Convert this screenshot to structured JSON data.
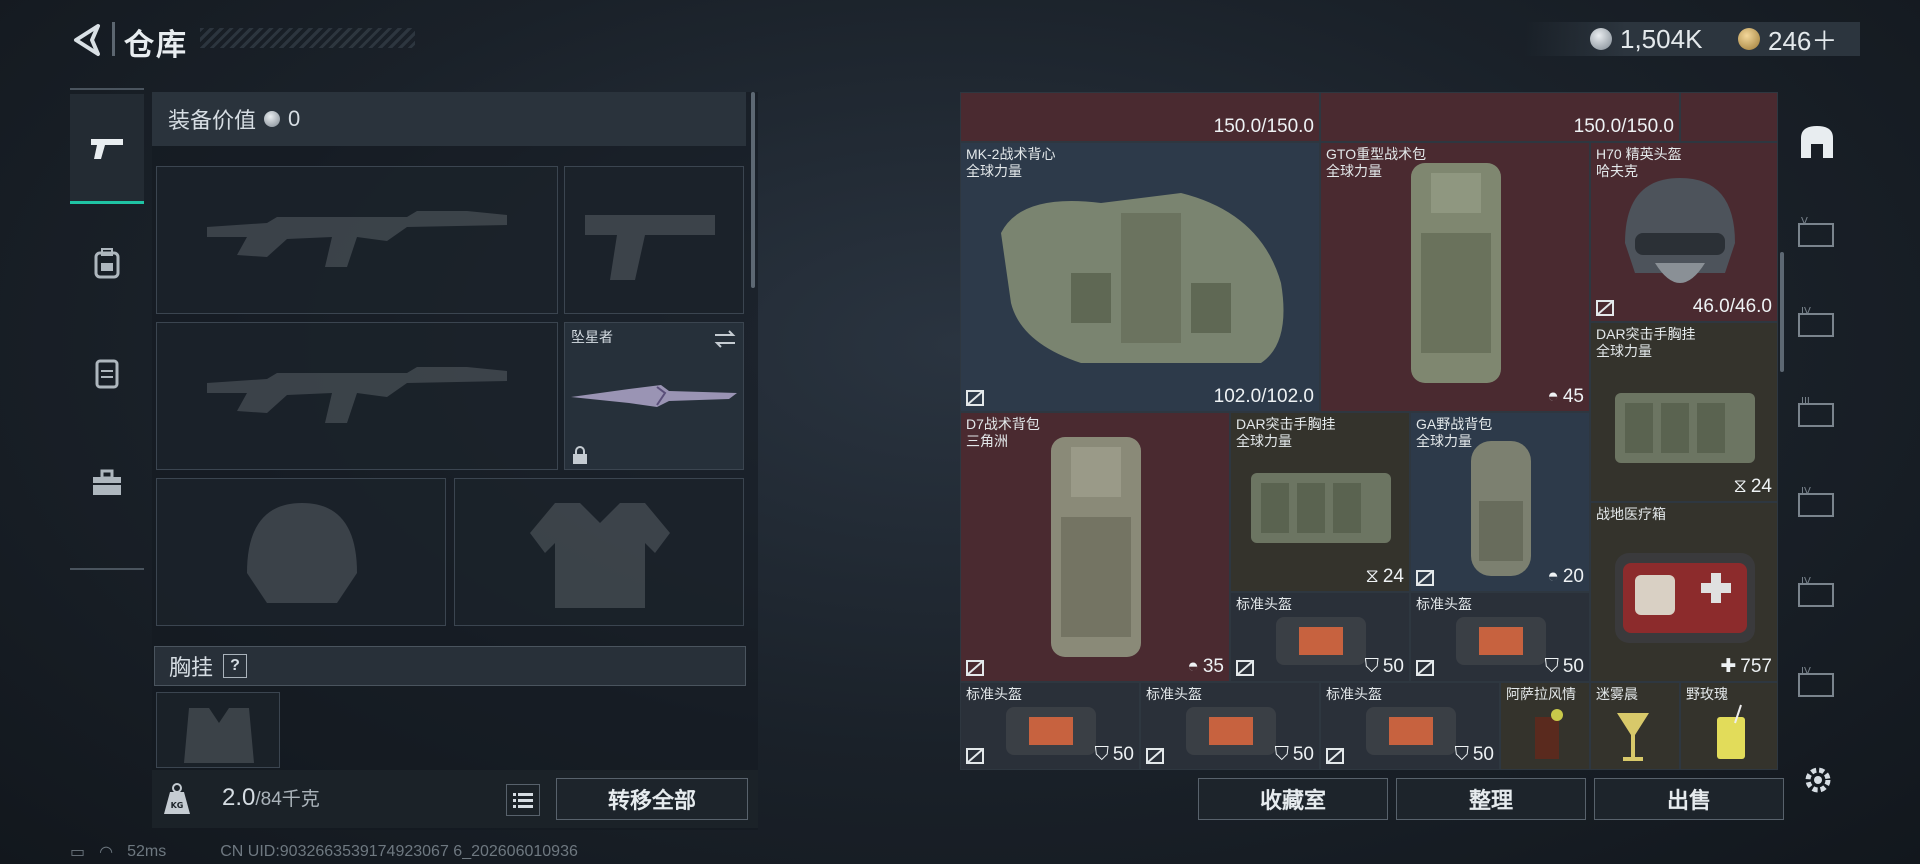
{
  "header": {
    "title": "仓库",
    "silver": "1,504K",
    "gold": "246＋"
  },
  "sidetabs": [
    {
      "icon": "pistol-icon"
    },
    {
      "icon": "backpack-icon"
    },
    {
      "icon": "vest-icon"
    },
    {
      "icon": "toolbox-icon"
    }
  ],
  "left": {
    "value_label": "装备价值",
    "value": "0",
    "melee_name": "坠星者",
    "section_label": "胸挂",
    "section_help": "?",
    "weight_current": "2.0",
    "weight_total": "/84千克",
    "transfer_label": "转移全部"
  },
  "grid": {
    "top_left_val": "150.0/150.0",
    "top_mid_val": "150.0/150.0",
    "items": [
      {
        "name": "MK-2战术背心",
        "sub": "全球力量",
        "val": "102.0/102.0",
        "color": "#8f9a84"
      },
      {
        "name": "GTO重型战术包",
        "sub": "全球力量",
        "val": "45",
        "color": "#7f8770"
      },
      {
        "name": "H70 精英头盔",
        "sub": "哈夫克",
        "val": "46.0/46.0",
        "color": "#5a6068"
      },
      {
        "name": "DAR突击手胸挂",
        "sub": "全球力量",
        "val": "24",
        "color": "#6c7562"
      },
      {
        "name": "D7战术背包",
        "sub": "三角洲",
        "val": "35",
        "color": "#8a8a78"
      },
      {
        "name": "DAR突击手胸挂",
        "sub": "全球力量",
        "val": "24",
        "color": "#6c7562"
      },
      {
        "name": "GA野战背包",
        "sub": "全球力量",
        "val": "20",
        "color": "#7c8070"
      },
      {
        "name": "战地医疗箱",
        "sub": "",
        "val": "757",
        "color": "#3a3a3c"
      },
      {
        "name": "标准头盔",
        "sub": "",
        "val": "50"
      },
      {
        "name": "标准头盔",
        "sub": "",
        "val": "50"
      },
      {
        "name": "标准头盔",
        "sub": "",
        "val": "50"
      },
      {
        "name": "标准头盔",
        "sub": "",
        "val": "50"
      },
      {
        "name": "标准头盔",
        "sub": "",
        "val": "50"
      },
      {
        "name": "阿萨拉风情",
        "sub": ""
      },
      {
        "name": "迷雾晨",
        "sub": ""
      },
      {
        "name": "野玫瑰",
        "sub": ""
      }
    ]
  },
  "bottom_buttons": {
    "collection": "收藏室",
    "organize": "整理",
    "sell": "出售"
  },
  "rightbar": {
    "tiers": [
      "V",
      "IV",
      "III",
      "IV",
      "IV",
      "IV"
    ],
    "gear_icon": "gear-icon",
    "top_icon": "storage-icon"
  },
  "status": {
    "ping": "52ms",
    "uid": "CN UID:9032663539174923067 6_202606010936"
  }
}
